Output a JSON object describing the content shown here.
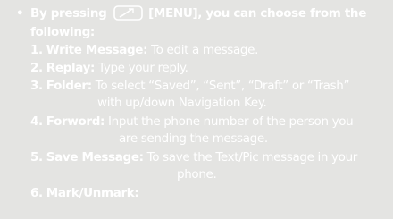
{
  "intro": {
    "bullet": "•",
    "text_before_key": "By pressing",
    "key_icon": "menu-soft-key-icon",
    "text_after_key": "[MENU], you can choose from the",
    "text_line2": "following:"
  },
  "items": [
    {
      "num": "1.",
      "title": "Write Message:",
      "desc": "To edit a message."
    },
    {
      "num": "2.",
      "title": "Replay:",
      "desc": "Type your reply."
    },
    {
      "num": "3.",
      "title": "Folder:",
      "desc": "To select “Saved”, “Sent”, “Draft” or “Trash”",
      "desc2": "with up/down Navigation Key."
    },
    {
      "num": "4.",
      "title": "Forword:",
      "desc": "Input the phone number of the person you",
      "desc2": "are sending the message."
    },
    {
      "num": "5.",
      "title": "Save Message:",
      "desc": "To save the Text/Pic message in your",
      "desc2": "phone."
    },
    {
      "num": "6.",
      "title": "Mark/Unmark:",
      "desc": ""
    }
  ],
  "colors": {
    "background": "#e4e4e2",
    "text": "#ffffff"
  }
}
